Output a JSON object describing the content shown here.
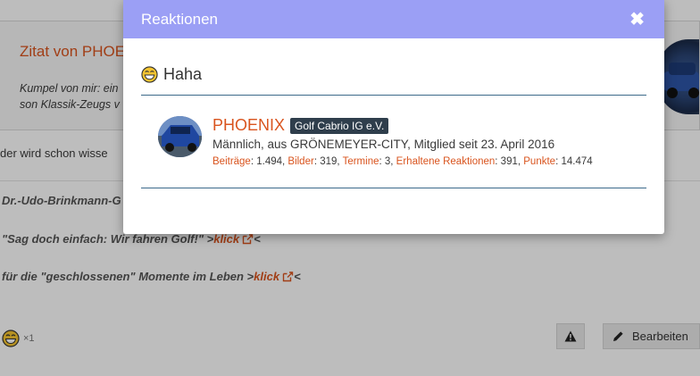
{
  "page": {
    "quote": {
      "title": "Zitat von PHOENIX",
      "line1": "Kumpel von mir: ein",
      "line2": "son Klassik-Zeugs v"
    },
    "post_line": "der wird schon wisse",
    "signature": {
      "name_line": "Dr.-Udo-Brinkmann-G",
      "line1_text": "\"Sag doch einfach: Wir fahren Golf!\" >",
      "line1_link": "klick",
      "line1_end": "<",
      "line2_text": "für die \"geschlossenen\" Momente im Leben >",
      "line2_link": "klick",
      "line2_end": "<"
    },
    "reaction_summary": {
      "count": "×1",
      "icon": "haha-emoji-icon"
    },
    "buttons": {
      "report_icon": "warning-icon",
      "edit_label": "Bearbeiten",
      "edit_icon": "pencil-icon"
    }
  },
  "modal": {
    "title": "Reaktionen",
    "close_icon": "close-icon",
    "reaction": {
      "name": "Haha",
      "icon": "haha-emoji-icon"
    },
    "user": {
      "name": "PHOENIX",
      "badge": "Golf Cabrio IG e.V.",
      "info": "Männlich, aus GRÖNEMEYER-CITY, Mitglied seit 23. April 2016",
      "stats": [
        {
          "key": "Beiträge",
          "value": "1.494"
        },
        {
          "key": "Bilder",
          "value": "319"
        },
        {
          "key": "Termine",
          "value": "3"
        },
        {
          "key": "Erhaltene Reaktionen",
          "value": "391"
        },
        {
          "key": "Punkte",
          "value": "14.474"
        }
      ]
    }
  },
  "colors": {
    "accent": "#d9541e",
    "modal_header": "#9b9ff5",
    "badge_bg": "#2f3e4c",
    "divider": "#3c6a8a"
  }
}
